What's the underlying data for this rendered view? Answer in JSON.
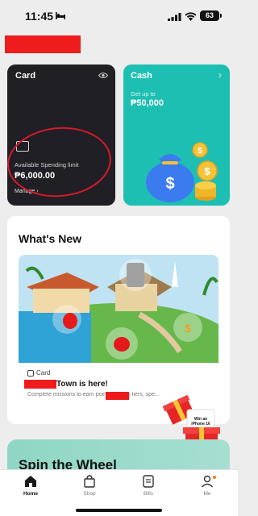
{
  "status": {
    "time": "11:45",
    "battery": "63"
  },
  "card": {
    "title": "Card",
    "limit_label": "Available Spending limit",
    "limit_value": "₱6,000.00",
    "manage": "Manage",
    "chevron": "›"
  },
  "cash": {
    "title": "Cash",
    "chevron": "›",
    "label": "Get up to",
    "value": "₱50,000"
  },
  "whats_new": {
    "title": "What's New",
    "promo": {
      "tag": "Card",
      "headline": "Town is here!",
      "description": "Complete missions to earn points, unlock tiers, spe..."
    }
  },
  "gift": {
    "text": "Win an iPhone 16"
  },
  "spin": {
    "title": "Spin the Wheel"
  },
  "tabs": [
    {
      "label": "Home",
      "icon": "home-icon"
    },
    {
      "label": "Shop",
      "icon": "bag-icon"
    },
    {
      "label": "Bills",
      "icon": "bill-icon"
    },
    {
      "label": "Me",
      "icon": "user-icon"
    }
  ],
  "colors": {
    "accent": "#1ebfb3",
    "card_bg": "#1f1f25",
    "annotation": "#d8192a",
    "redaction": "#ee1c1c"
  }
}
